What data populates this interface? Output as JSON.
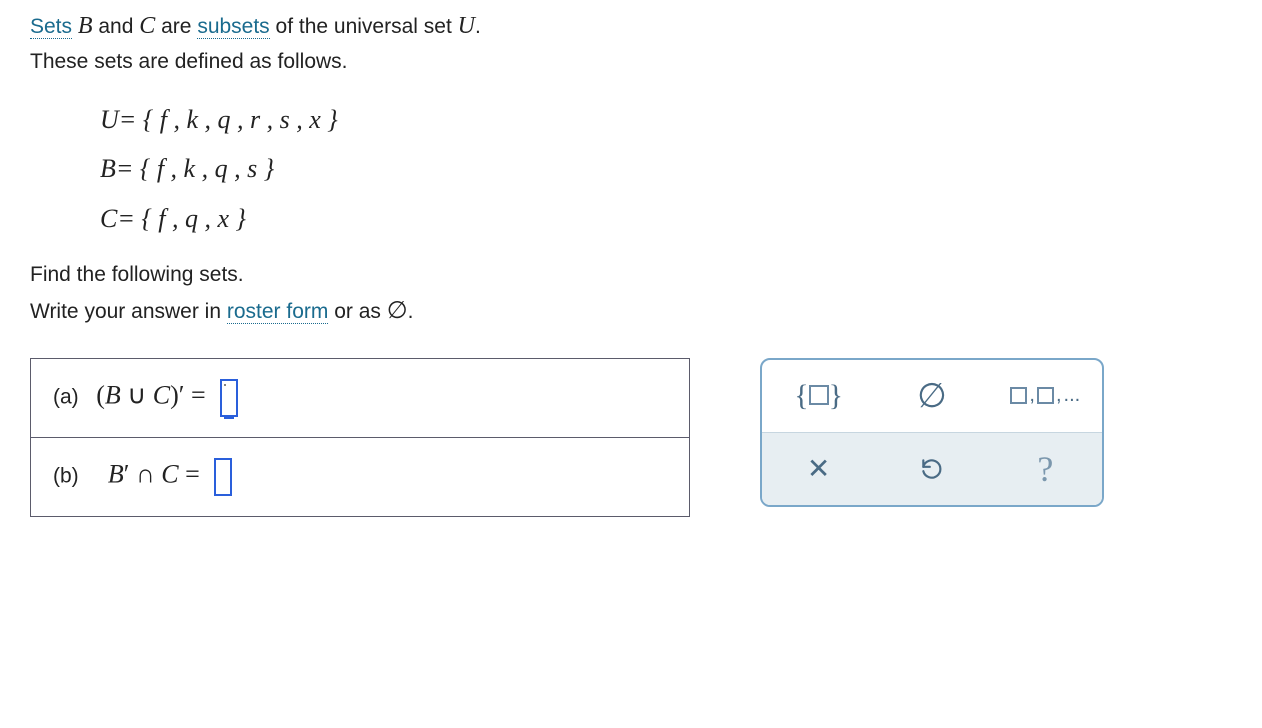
{
  "intro": {
    "line1_pre": "",
    "link_sets": "Sets",
    "line1_mid1": " ",
    "B": "B",
    "line1_and": " and ",
    "C": "C",
    "line1_are": " are ",
    "link_subsets": "subsets",
    "line1_post": " of the universal set ",
    "U": "U",
    "line1_end": ".",
    "line2": "These sets are defined as follows."
  },
  "defs": {
    "U": "U= { f , k , q , r , s , x }",
    "B": "B= { f , k , q , s }",
    "C": "C= { f , q , x }"
  },
  "prompt": {
    "line1": "Find the following sets.",
    "line2_pre": "Write your answer in ",
    "link_roster": "roster form",
    "line2_post": " or as ",
    "empty": "∅",
    "line2_end": "."
  },
  "parts": {
    "a_label": "(a)",
    "a_expr_left": "(",
    "a_B": "B",
    "a_union": " ∪ ",
    "a_C": "C",
    "a_expr_right": ")",
    "a_prime": "′",
    "a_eq": " = ",
    "b_label": "(b)",
    "b_B": "B",
    "b_prime": "′",
    "b_inter": " ∩ ",
    "b_C": "C",
    "b_eq": " = "
  },
  "palette": {
    "set_braces_open": "{",
    "set_braces_close": "}",
    "emptyset": "∅",
    "list_sep": ",",
    "list_ellipsis": "...",
    "clear": "×",
    "undo": "↺",
    "help": "?"
  }
}
